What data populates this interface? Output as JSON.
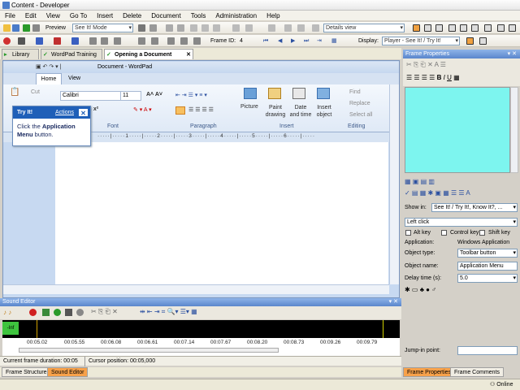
{
  "window": {
    "title": "Content - Developer"
  },
  "menu": [
    "File",
    "Edit",
    "View",
    "Go To",
    "Insert",
    "Delete",
    "Document",
    "Tools",
    "Administration",
    "Help"
  ],
  "toolbar1": {
    "preview_label": "Preview",
    "mode_value": "See It! Mode",
    "view_value": "Details view"
  },
  "toolbar2": {
    "frame_label": "Frame ID:",
    "frame_value": "4",
    "display_label": "Display:",
    "display_value": "Player - See It! / Try It!"
  },
  "doc_tabs": [
    {
      "label": "Library"
    },
    {
      "label": "WordPad Training"
    },
    {
      "label": "Opening a Document"
    }
  ],
  "wordpad": {
    "title": "Document - WordPad",
    "tabs": [
      "Home",
      "View"
    ],
    "clipboard": {
      "cut": "Cut"
    },
    "font_name": "Calibri",
    "font_size": "11",
    "groups": [
      "Font",
      "Paragraph",
      "Insert",
      "Editing"
    ],
    "insert_buttons": [
      "Picture",
      "Paint drawing",
      "Date and time",
      "Insert object"
    ],
    "editing_buttons": [
      "Find",
      "Replace",
      "Select all"
    ]
  },
  "tooltip": {
    "title": "Try It!",
    "actions": "Actions",
    "text_1": "Click the ",
    "text_bold": "Application Menu",
    "text_2": " button."
  },
  "sound_editor": {
    "title": "Sound Editor",
    "marker": "-Inf",
    "ticks": [
      "00:05.02",
      "00:05.55",
      "00:06.08",
      "00:06.61",
      "00:07.14",
      "00:07.67",
      "00:08.20",
      "00:08.73",
      "00:09.26",
      "00:09.79"
    ],
    "duration": "Current frame duration: 00:05",
    "cursor": "Cursor position: 00:05,000"
  },
  "bottom_tabs": [
    "Frame Structure",
    "Sound Editor"
  ],
  "frame_properties": {
    "title": "Frame Properties",
    "show_in_label": "Show in:",
    "show_in_value": "See It! / Try It!, Know It?, ...",
    "action": "Left click",
    "alt_key": "Alt key",
    "control_key": "Control key",
    "shift_key": "Shift key",
    "application_label": "Application:",
    "application_value": "Windows Application",
    "object_type_label": "Object type:",
    "object_type_value": "Toolbar button",
    "object_name_label": "Object name:",
    "object_name_value": "Application Menu",
    "delay_label": "Delay time (s):",
    "delay_value": "5.0",
    "jump_in_label": "Jump-in point:",
    "tabs": [
      "Frame Properties",
      "Frame Comments"
    ]
  },
  "status": {
    "online": "Online"
  }
}
